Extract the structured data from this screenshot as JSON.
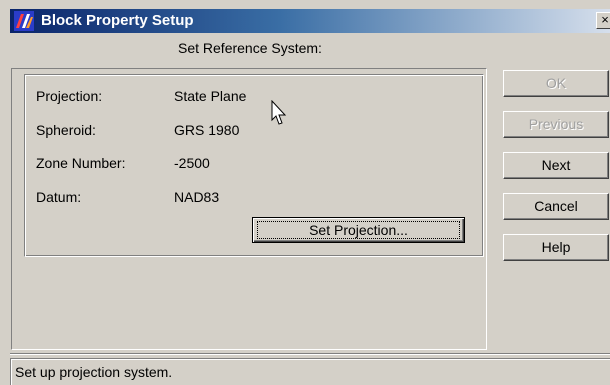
{
  "window": {
    "title": "Block Property Setup",
    "close_label": "×"
  },
  "header": {
    "subtitle": "Set Reference System:"
  },
  "info": {
    "projection_label": "Projection:",
    "projection_value": "State Plane",
    "spheroid_label": "Spheroid:",
    "spheroid_value": "GRS 1980",
    "zone_label": "Zone Number:",
    "zone_value": "-2500",
    "datum_label": "Datum:",
    "datum_value": "NAD83",
    "set_projection_label": "Set Projection..."
  },
  "buttons": {
    "ok": "OK",
    "previous": "Previous",
    "next": "Next",
    "cancel": "Cancel",
    "help": "Help"
  },
  "status": {
    "text": "Set up projection system."
  },
  "icons": {
    "title_icon": "app-logo-icon",
    "cursor": "mouse-pointer-icon"
  },
  "colors": {
    "titlebar_start": "#0a246a",
    "titlebar_end": "#d6dfec",
    "face": "#d4d0c8"
  }
}
